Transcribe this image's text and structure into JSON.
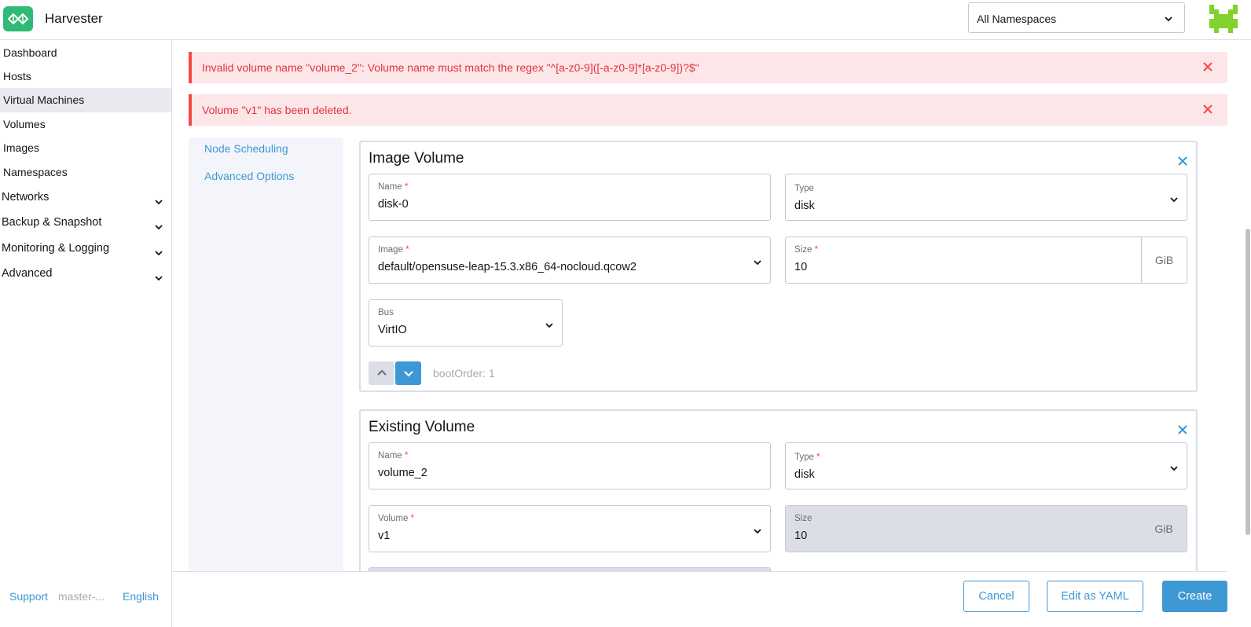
{
  "header": {
    "app_title": "Harvester",
    "namespace_selected": "All Namespaces"
  },
  "sidebar": {
    "items": [
      {
        "label": "Dashboard"
      },
      {
        "label": "Hosts"
      },
      {
        "label": "Virtual Machines"
      },
      {
        "label": "Volumes"
      },
      {
        "label": "Images"
      },
      {
        "label": "Namespaces"
      }
    ],
    "groups": [
      {
        "label": "Networks"
      },
      {
        "label": "Backup & Snapshot"
      },
      {
        "label": "Monitoring & Logging"
      },
      {
        "label": "Advanced"
      }
    ],
    "footer": {
      "support": "Support",
      "version": "master-...",
      "language": "English"
    }
  },
  "alerts": [
    {
      "message": "Invalid volume name \"volume_2\": Volume name must match the regex \"^[a-z0-9]([-a-z0-9]*[a-z0-9])?$\""
    },
    {
      "message": "Volume \"v1\" has been deleted."
    }
  ],
  "tabs": [
    {
      "label": "Node Scheduling"
    },
    {
      "label": "Advanced Options"
    }
  ],
  "volumes": [
    {
      "title": "Image Volume",
      "name_label": "Name",
      "name_value": "disk-0",
      "type_label": "Type",
      "type_value": "disk",
      "image_label": "Image",
      "image_value": "default/opensuse-leap-15.3.x86_64-nocloud.qcow2",
      "size_label": "Size",
      "size_value": "10",
      "size_unit": "GiB",
      "bus_label": "Bus",
      "bus_value": "VirtIO",
      "boot_order": "bootOrder: 1"
    },
    {
      "title": "Existing Volume",
      "name_label": "Name",
      "name_value": "volume_2",
      "type_label": "Type",
      "type_value": "disk",
      "volume_label": "Volume",
      "volume_value": "v1",
      "size_label": "Size",
      "size_value": "10",
      "size_unit": "GiB"
    }
  ],
  "footer": {
    "cancel": "Cancel",
    "edit_yaml": "Edit as YAML",
    "create": "Create"
  },
  "colors": {
    "accent": "#3d98d3",
    "error": "#f64747",
    "brand": "#30ba78"
  },
  "icons": {
    "logo": "harvester-logo-icon",
    "avatar": "user-avatar-icon",
    "chevron": "chevron-down-icon",
    "close": "close-icon"
  }
}
